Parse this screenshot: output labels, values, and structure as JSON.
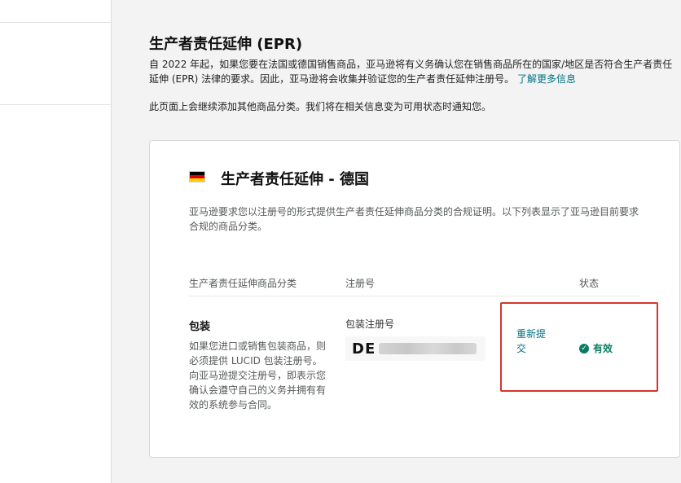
{
  "page": {
    "title": "生产者责任延伸 (EPR)",
    "intro": "自 2022 年起，如果您要在法国或德国销售商品，亚马逊将有义务确认您在销售商品所在的国家/地区是否符合生产者责任延伸 (EPR) 法律的要求。因此，亚马逊将会收集并验证您的生产者责任延伸注册号。",
    "learn_more": "了解更多信息",
    "note": "此页面上会继续添加其他商品分类。我们将在相关信息变为可用状态时通知您。"
  },
  "card": {
    "flag_colors": [
      "#000000",
      "#dd0000",
      "#ffce00"
    ],
    "title": "生产者责任延伸 - 德国",
    "description": "亚马逊要求您以注册号的形式提供生产者责任延伸商品分类的合规证明。以下列表显示了亚马逊目前要求合规的商品分类。",
    "columns": [
      "生产者责任延伸商品分类",
      "注册号",
      "状态"
    ],
    "row": {
      "category": "包装",
      "category_desc": "如果您进口或销售包装商品，则必须提供 LUCID 包装注册号。向亚马逊提交注册号，即表示您确认会遵守自己的义务并拥有有效的系统参与合同。",
      "reg_label": "包装注册号",
      "reg_value": "DE",
      "action": "重新提交",
      "status": "有效",
      "status_icon": "check-circle-icon"
    }
  },
  "colors": {
    "link": "#007185",
    "status_ok": "#067d62",
    "highlight": "#d9342b"
  }
}
